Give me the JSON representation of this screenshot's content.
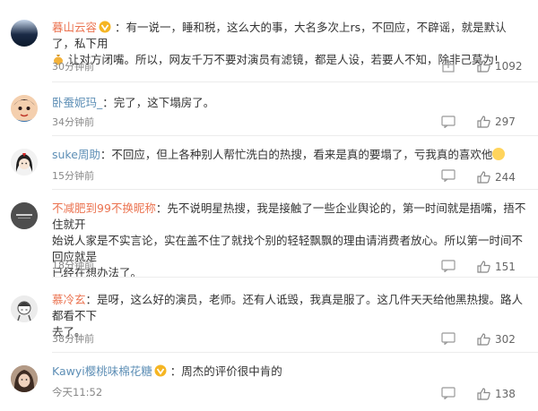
{
  "comments": [
    {
      "user": "暮山云容",
      "text": "：有一说一，睡和税，这么大的事，大名多次上rs，不回应，不辟谣，就是默认了，私下用",
      "text2": "让对方闭嘴。所以，网友千万不要对演员有滤镜，都是人设，若要人不知，除非己莫为!",
      "time": "30分钟前",
      "likes": "1092"
    },
    {
      "user": "卧蚕妮玛_",
      "text": "：完了，这下塌房了。",
      "time": "34分钟前",
      "likes": "297"
    },
    {
      "user": "suke周助",
      "text": "：不回应，但上各种别人帮忙洗白的热搜，看来是真的要塌了，亏我真的喜欢他",
      "time": "15分钟前",
      "likes": "244"
    },
    {
      "user": "不减肥到99不换昵称",
      "text": "：先不说明星热搜，我是接触了一些企业舆论的，第一时间就是捂嘴，捂不住就开",
      "text2": "始说人家是不实言论，实在盖不住了就找个别的轻轻飘飘的理由请消费者放心。所以第一时间不回应就是",
      "text3": "已经在想办法了。",
      "time": "18分钟前",
      "likes": "151"
    },
    {
      "user": "慕冷玄",
      "text": "：是呀，这么好的演员，老师。还有人诋毁，我真是服了。这几件天天给他黑热搜。路人都看不下",
      "text2": "去了。",
      "time": "38分钟前",
      "likes": "302"
    },
    {
      "user": "Kawyi樱桃味棉花糖",
      "text": "：周杰的评价很中肯的",
      "time": "今天11:52",
      "likes": "138"
    }
  ],
  "colors": {
    "username": "#eb7350",
    "username_alt": "#5e8fb6",
    "meta": "#888888"
  },
  "icons": [
    "vip-badge-icon",
    "share-icon",
    "reply-icon",
    "like-icon",
    "emoji-icon"
  ]
}
